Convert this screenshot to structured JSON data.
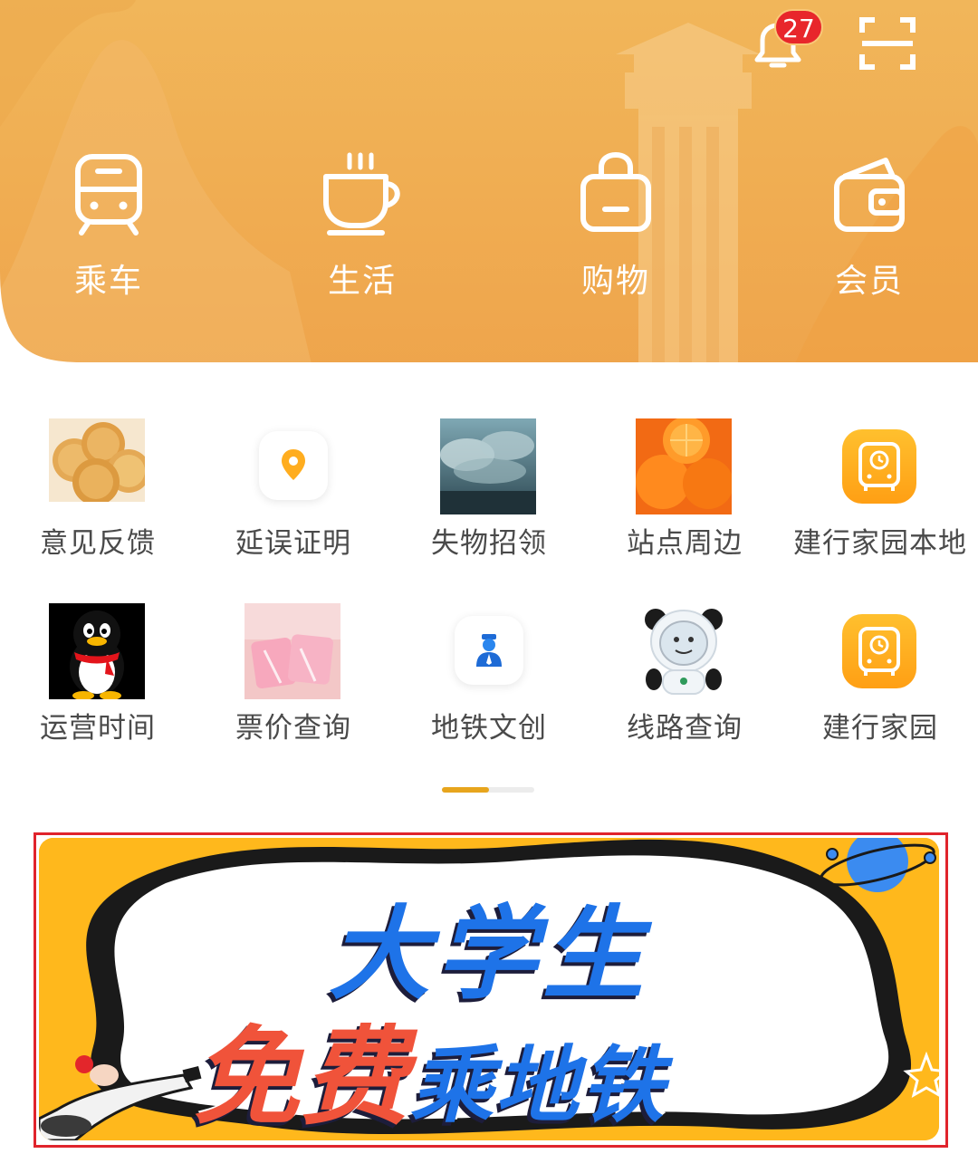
{
  "header": {
    "notification_count": "27",
    "icons": [
      "bell-icon",
      "scan-icon"
    ]
  },
  "main_nav": [
    {
      "label": "乘车",
      "icon": "train-icon"
    },
    {
      "label": "生活",
      "icon": "coffee-cup-icon"
    },
    {
      "label": "购物",
      "icon": "shopping-bag-icon"
    },
    {
      "label": "会员",
      "icon": "wallet-icon"
    }
  ],
  "services": [
    {
      "label": "意见反馈",
      "icon": "crackers-thumbnail"
    },
    {
      "label": "延误证明",
      "icon": "location-pin-icon"
    },
    {
      "label": "失物招领",
      "icon": "clouds-thumbnail"
    },
    {
      "label": "站点周边",
      "icon": "oranges-thumbnail"
    },
    {
      "label": "建行家园本地",
      "icon": "bus-clock-icon"
    },
    {
      "label": "运营时间",
      "icon": "penguin-thumbnail"
    },
    {
      "label": "票价查询",
      "icon": "tissue-pack-thumbnail"
    },
    {
      "label": "地铁文创",
      "icon": "staff-person-icon"
    },
    {
      "label": "线路查询",
      "icon": "panda-mascot-thumbnail"
    },
    {
      "label": "建行家园",
      "icon": "bus-clock-icon"
    }
  ],
  "pager": {
    "pages": 2,
    "active": 1
  },
  "banner": {
    "line1": "大学生",
    "line2_highlight": "免费",
    "line2_rest": "乘地铁"
  },
  "colors": {
    "hero_orange": "#f0ad52",
    "badge_red": "#e8262b",
    "pager_active": "#e7a51d",
    "banner_yellow": "#ffb81c",
    "banner_blue": "#1e73e8",
    "banner_red": "#f0533a",
    "selection_outline": "#e0242c"
  }
}
